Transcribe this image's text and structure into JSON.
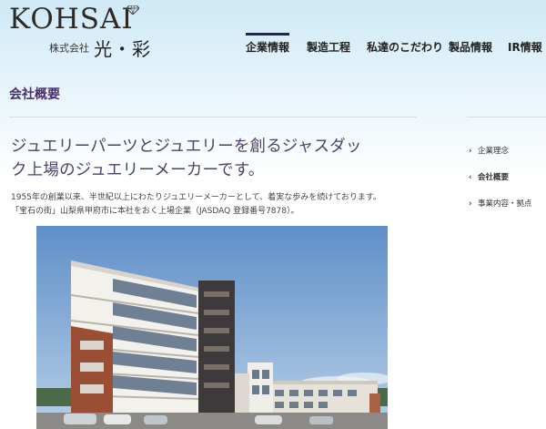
{
  "header": {
    "logo_word": "KOHSAI",
    "logo_kabushiki": "株式会社",
    "logo_kanji": "光・彩"
  },
  "nav": {
    "items": [
      {
        "label": "企業情報",
        "active": true
      },
      {
        "label": "製造工程"
      },
      {
        "label": "私達のこだわり"
      },
      {
        "label": "製品情報"
      },
      {
        "label": "IR情報"
      }
    ]
  },
  "page_title": "会社概要",
  "main": {
    "headline_line1": "ジュエリーパーツとジュエリーを創るジャスダッ",
    "headline_line2": "ク上場のジュエリーメーカーです。",
    "lead_line1": "1955年の創業以来、半世紀以上にわたりジュエリーメーカーとして、着実な歩みを続けております。",
    "lead_line2": "「宝石の街」山梨県甲府市に本社をおく上場企業（JASDAQ 登録番号7878）。"
  },
  "side_nav": {
    "items": [
      {
        "label": "企業理念",
        "icon": "chevron-right-icon"
      },
      {
        "label": "会社概要",
        "icon": "chevron-left-icon",
        "current": true
      },
      {
        "label": "事業内容・拠点",
        "icon": "chevron-right-icon"
      }
    ]
  },
  "colors": {
    "title_purple": "#4a2f6e",
    "headline": "#4b4269",
    "nav_active_bar": "#1d2b4a"
  }
}
